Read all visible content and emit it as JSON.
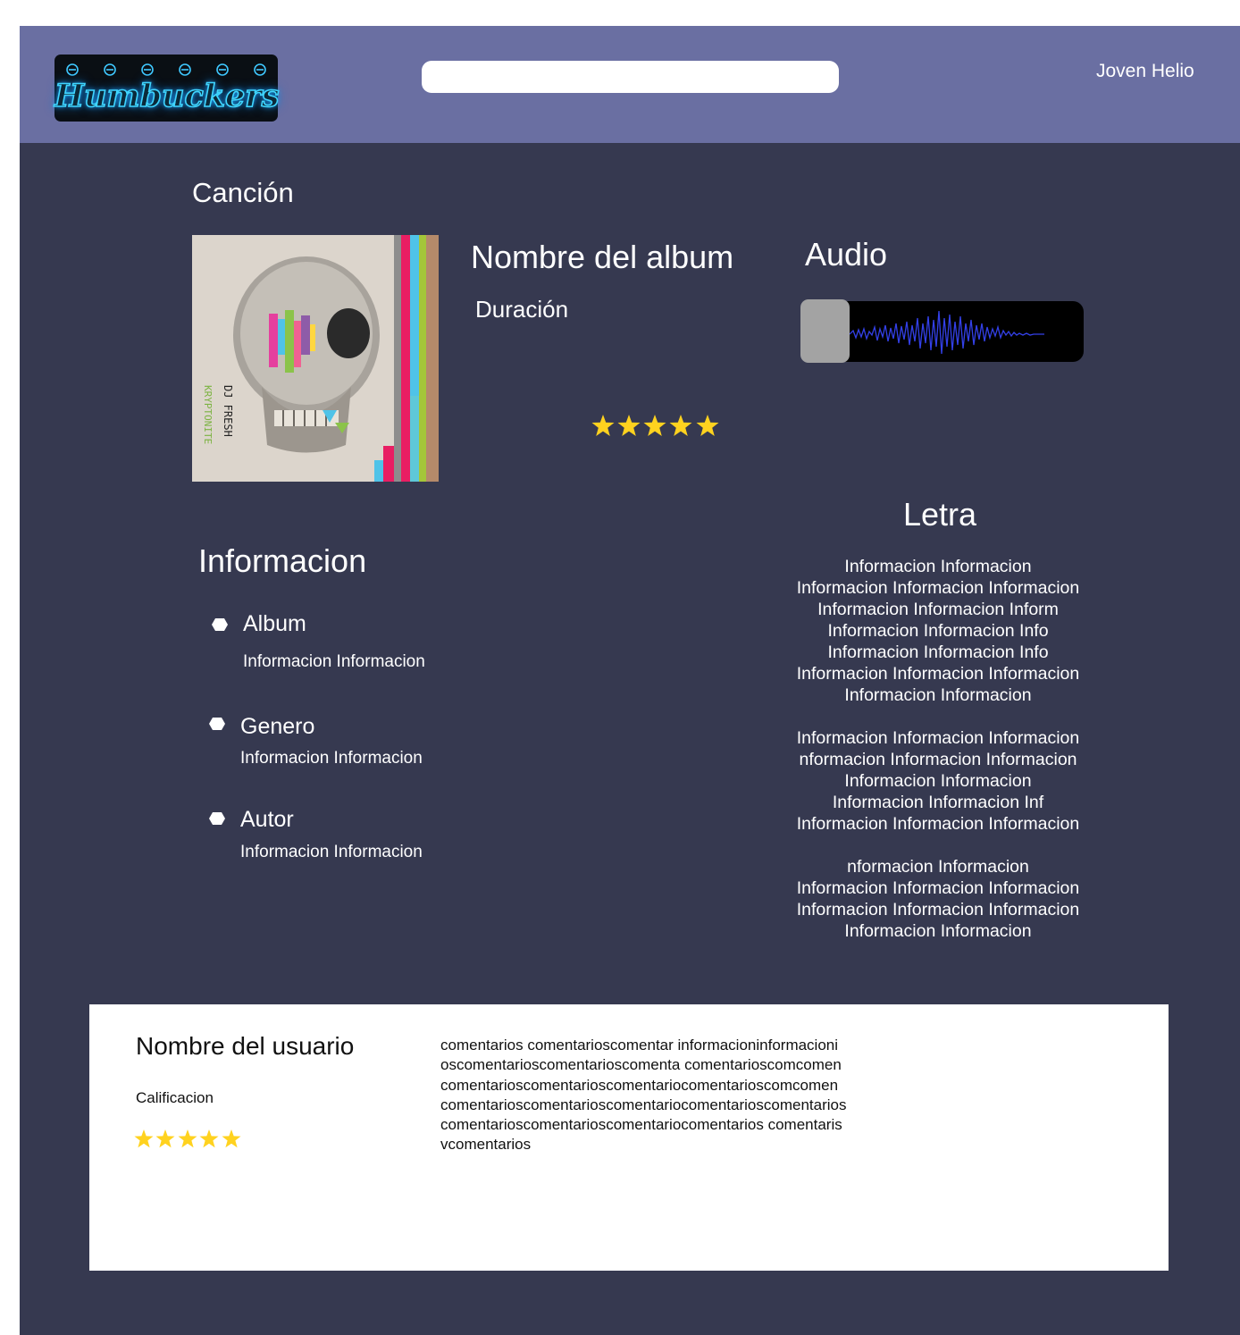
{
  "header": {
    "logo_text": "Humbuckers",
    "search": {
      "placeholder": "",
      "value": ""
    },
    "user_name": "Joven Helio"
  },
  "song": {
    "heading": "Canción",
    "album_name": "Nombre del album",
    "duration_label": "Duración",
    "rating_stars": 5,
    "cover_art": {
      "artist": "DJ FRESH",
      "title": "KRYPTONITE",
      "description": "skull-artwork"
    }
  },
  "audio": {
    "heading": "Audio",
    "player_icon": "audio-waveform-icon"
  },
  "info": {
    "heading": "Informacion",
    "items": [
      {
        "title": "Album",
        "value": "Informacion Informacion"
      },
      {
        "title": "Genero",
        "value": "Informacion Informacion"
      },
      {
        "title": "Autor",
        "value": "Informacion Informacion"
      }
    ]
  },
  "lyrics": {
    "heading": "Letra",
    "stanzas": [
      [
        "Informacion Informacion",
        "Informacion Informacion Informacion",
        "Informacion Informacion Inform",
        "Informacion Informacion Info",
        "Informacion Informacion Info",
        "Informacion Informacion Informacion",
        "Informacion Informacion"
      ],
      [
        "Informacion Informacion Informacion",
        "nformacion Informacion Informacion",
        "Informacion Informacion",
        "Informacion Informacion Inf",
        "Informacion Informacion Informacion"
      ],
      [
        "nformacion Informacion",
        "Informacion Informacion Informacion",
        "Informacion Informacion Informacion",
        "Informacion Informacion"
      ]
    ]
  },
  "comment": {
    "user_name": "Nombre del usuario",
    "rating_label": "Calificacion",
    "rating_stars": 5,
    "lines": [
      "comentarios comentarioscomentar informacioninformacioni",
      "oscomentarioscomentarioscomenta comentarioscomcomen",
      "comentarioscomentarioscomentariocomentarioscomcomen",
      "comentarioscomentarioscomentariocomentarioscomentarios",
      "comentarioscomentarioscomentariocomentarios comentaris",
      "vcomentarios"
    ]
  },
  "colors": {
    "header_bg": "#6a6fa2",
    "page_bg": "#363950",
    "star": "#ffd21f",
    "waveform": "#3340e8",
    "logo_neon": "#3fd5ff"
  }
}
